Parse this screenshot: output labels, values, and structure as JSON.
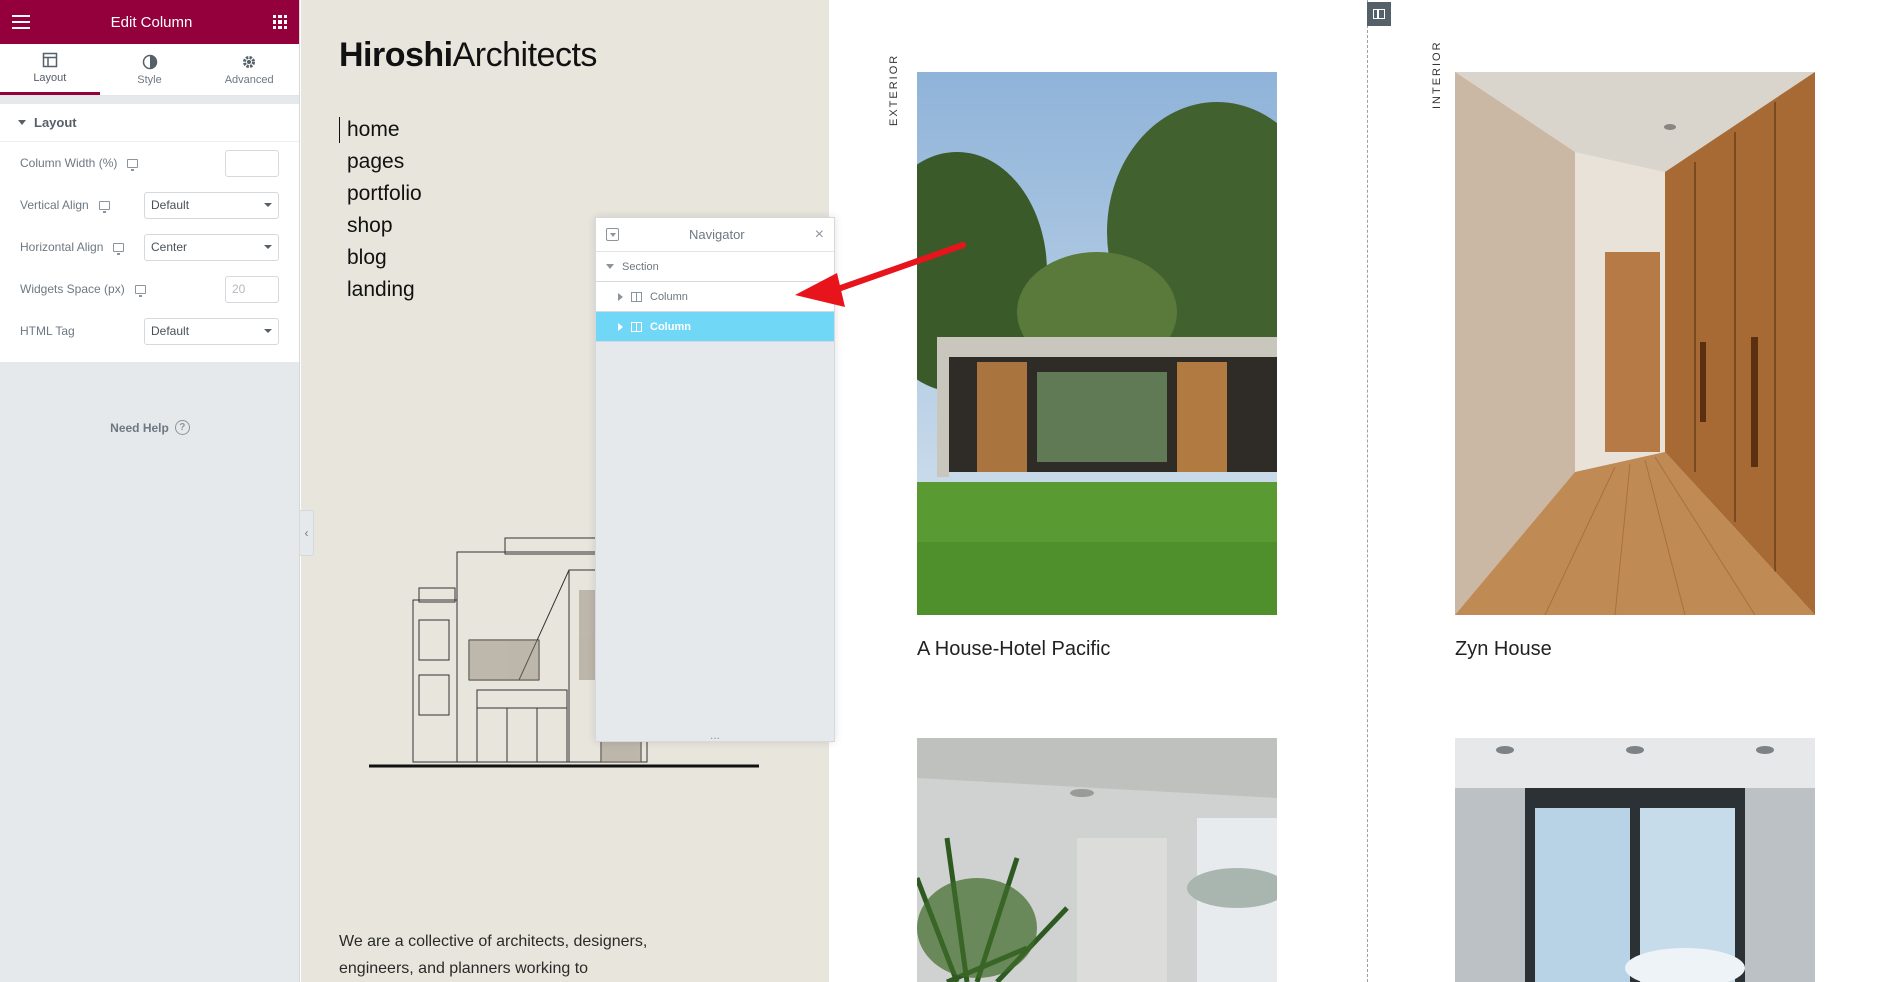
{
  "panel": {
    "title": "Edit Column",
    "tabs": [
      {
        "label": "Layout",
        "icon": "layout-icon",
        "active": true
      },
      {
        "label": "Style",
        "icon": "style-icon",
        "active": false
      },
      {
        "label": "Advanced",
        "icon": "gear-icon",
        "active": false
      }
    ],
    "section_title": "Layout",
    "controls": {
      "column_width": {
        "label": "Column Width (%)",
        "value": ""
      },
      "vertical_align": {
        "label": "Vertical Align",
        "value": "Default"
      },
      "horizontal_align": {
        "label": "Horizontal Align",
        "value": "Center"
      },
      "widgets_space": {
        "label": "Widgets Space (px)",
        "placeholder": "20"
      },
      "html_tag": {
        "label": "HTML Tag",
        "value": "Default"
      }
    },
    "help": "Need Help",
    "colors": {
      "brand": "#93003c"
    }
  },
  "site": {
    "logo_bold": "Hiroshi",
    "logo_light": "Architects",
    "menu": [
      "home",
      "pages",
      "portfolio",
      "shop",
      "blog",
      "landing"
    ],
    "intro": "We are a collective of architects, designers, engineers, and planners working to",
    "labels": {
      "exterior": "EXTERIOR",
      "interior": "INTERIOR"
    },
    "projects": {
      "first": "A House-Hotel Pacific",
      "second": "Zyn House"
    }
  },
  "navigator": {
    "title": "Navigator",
    "section": "Section",
    "columns": [
      "Column",
      "Column"
    ],
    "selected_index": 1,
    "grip": "...",
    "colors": {
      "selected": "#71d7f7"
    }
  },
  "annotation": {
    "arrow_color": "#e8141b"
  }
}
